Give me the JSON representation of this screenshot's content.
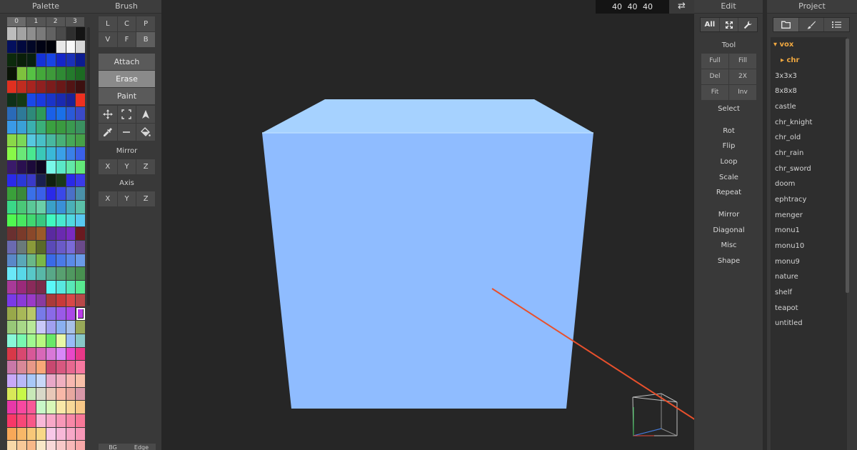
{
  "palette": {
    "title": "Palette",
    "tabs": [
      "0",
      "1",
      "2",
      "3"
    ],
    "active_tab": 0,
    "selected_index": 175,
    "rows": [
      [
        "#bdbdbd",
        "#a3a3a3",
        "#8e8e8e",
        "#7a7a7a",
        "#626262",
        "#4a4a4a",
        "#2e2e2e",
        "#141414"
      ],
      [
        "#04105e",
        "#02093e",
        "#020726",
        "#010314",
        "#01020a",
        "#e8e8e8",
        "#f8f8f8",
        "#d6d6d6"
      ],
      [
        "#0c2a0c",
        "#0a1f0a",
        "#082010",
        "#1432d6",
        "#1844e4",
        "#1426c8",
        "#1a30b8",
        "#0c1c90"
      ],
      [
        "#0a1406",
        "#7ec13e",
        "#56c244",
        "#44a83a",
        "#3e9a3a",
        "#2f8a34",
        "#247a2c",
        "#1c6a22"
      ],
      [
        "#e03020",
        "#c02c20",
        "#a82420",
        "#902020",
        "#7c1c1c",
        "#6a1818",
        "#521414",
        "#3c1010"
      ],
      [
        "#0e3018",
        "#143a14",
        "#1a48e8",
        "#1a3ae0",
        "#1a34c8",
        "#1a2ab0",
        "#1a2298",
        "#ee3020"
      ],
      [
        "#2a6ab8",
        "#2e7a98",
        "#2e8a7a",
        "#2e9a5a",
        "#1a60e8",
        "#1a70e8",
        "#2a5ad8",
        "#3a4ac8"
      ],
      [
        "#3a9ae8",
        "#3aa0d8",
        "#3ab0b0",
        "#3ab07a",
        "#3aa040",
        "#3a9a40",
        "#3a9a50",
        "#3a9060"
      ],
      [
        "#8ad848",
        "#7ad858",
        "#56c8e0",
        "#48c0c8",
        "#48b8a0",
        "#48b078",
        "#46a858",
        "#46a048"
      ],
      [
        "#88f848",
        "#6ae878",
        "#4ae890",
        "#3ac8b8",
        "#3ab8d8",
        "#3aa0e8",
        "#3a80e8",
        "#3a60e8"
      ],
      [
        "#3a1a6a",
        "#2a1050",
        "#1c0a3a",
        "#0e0620",
        "#78f8e8",
        "#5ae8c8",
        "#62e8a8",
        "#62e878"
      ],
      [
        "#2a2ae8",
        "#2a38d8",
        "#3a3ac8",
        "#1a2050",
        "#102010",
        "#1a3a1a",
        "#2a2ae8",
        "#3a3ae8"
      ],
      [
        "#3aa03a",
        "#3a8a3a",
        "#3a70e8",
        "#3a60e8",
        "#2a2ae8",
        "#3a48e8",
        "#4a70c8",
        "#4a90a8"
      ],
      [
        "#3ad888",
        "#4ac878",
        "#5ac898",
        "#6ad0a8",
        "#3aa0c8",
        "#3a90d8",
        "#4ab0b8",
        "#5ac0a8"
      ],
      [
        "#50f850",
        "#48e860",
        "#40d870",
        "#38c880",
        "#40f8c0",
        "#48e8d0",
        "#50d8e0",
        "#58c8f0"
      ],
      [
        "#6a3030",
        "#7a3a2a",
        "#8a482a",
        "#9a5a2a",
        "#5a2aa0",
        "#6a2ab0",
        "#7a2ac0",
        "#6a1a20"
      ],
      [
        "#6a6ab0",
        "#6a7a7a",
        "#8a9a3a",
        "#5a6a2a",
        "#5a4ab8",
        "#6a5ac8",
        "#7a6ad8",
        "#6a4a8a"
      ],
      [
        "#5a88c8",
        "#5aa8b8",
        "#6ab888",
        "#7ab848",
        "#3a6ae8",
        "#4a7ae8",
        "#5a8ae8",
        "#6a9ae8"
      ],
      [
        "#6ae8f8",
        "#58d8e8",
        "#58c8c8",
        "#58b8a8",
        "#58a888",
        "#58a070",
        "#509860",
        "#489050"
      ],
      [
        "#a83a98",
        "#9a2a7a",
        "#8a2a5a",
        "#7a2a4a",
        "#5af8f8",
        "#58e8e0",
        "#58e8b8",
        "#58e890"
      ],
      [
        "#7a3ae8",
        "#8a3ad8",
        "#9a3ac8",
        "#8a3aa0",
        "#aa3a3a",
        "#c83a3a",
        "#d84848",
        "#b84848"
      ],
      [
        "#98a84a",
        "#a8b858",
        "#b8c868",
        "#787ae8",
        "#8a6ae8",
        "#9a5ae8",
        "#aa4ae8",
        "#ba3ae8"
      ],
      [
        "#98c878",
        "#a8d888",
        "#b8e898",
        "#c8c8f8",
        "#a0a0f0",
        "#8ab0f0",
        "#a8c0e8",
        "#98a858"
      ],
      [
        "#88f8d8",
        "#78f8b0",
        "#a0f890",
        "#b8f880",
        "#68e868",
        "#e8f8a8",
        "#98bcf8",
        "#88c8c8"
      ],
      [
        "#d83848",
        "#d84870",
        "#d85898",
        "#d868b8",
        "#d878d8",
        "#d888f8",
        "#e848c8",
        "#e83888"
      ],
      [
        "#c878a8",
        "#d88898",
        "#e89888",
        "#f8a878",
        "#c84870",
        "#d85880",
        "#e86890",
        "#f878a0"
      ],
      [
        "#c8a8f8",
        "#b8b8f8",
        "#a8c8f8",
        "#c8d8f8",
        "#e8a8c8",
        "#f0b0c0",
        "#f8b8b0",
        "#f8c0a8"
      ],
      [
        "#d8e858",
        "#c8f848",
        "#c8e8b8",
        "#d8d8c8",
        "#e8c8b8",
        "#f8b8a8",
        "#e8a8a0",
        "#d898a8"
      ],
      [
        "#e838a8",
        "#f848a0",
        "#f85898",
        "#c8f8c8",
        "#d8f8b8",
        "#f8e8a8",
        "#f8d898",
        "#f8c888"
      ],
      [
        "#f83868",
        "#f84878",
        "#f85888",
        "#f8b8d8",
        "#f8a8c8",
        "#f898b8",
        "#f888a8",
        "#f87898"
      ],
      [
        "#f8a858",
        "#f8b868",
        "#f8c878",
        "#f8d888",
        "#f8c8e8",
        "#f8b8d8",
        "#f8a8c8",
        "#f898b8"
      ],
      [
        "#f8d8a8",
        "#f8c898",
        "#f8b888",
        "#f8e8c8",
        "#f8d8d8",
        "#f8c8c8",
        "#f8b8b8",
        "#f8a8a8"
      ],
      [
        "#f8e8a8",
        "#f8f0b8",
        "#f8f8c8",
        "#f8e8e8",
        "#f8f0f0",
        "#f8f8f8",
        "#f0f0f0",
        "#e8e8e8"
      ]
    ]
  },
  "brush": {
    "title": "Brush",
    "row1": [
      "L",
      "C",
      "P"
    ],
    "row2": [
      "V",
      "F",
      "B"
    ],
    "modes": {
      "attach": "Attach",
      "erase": "Erase",
      "paint": "Paint"
    },
    "active_mode": "erase",
    "mirror_label": "Mirror",
    "mirror": [
      "X",
      "Y",
      "Z"
    ],
    "axis_label": "Axis",
    "axis": [
      "X",
      "Y",
      "Z"
    ],
    "bottom_tabs": [
      "BG",
      "Edge"
    ]
  },
  "viewport": {
    "dimensions": "40 40 40",
    "swap_glyph": "⇄",
    "cube_colors": {
      "top": "#a6d2ff",
      "front": "#8fbcff",
      "side_shadow": "#7fa8e6"
    },
    "ray_color": "#e8502c"
  },
  "edit": {
    "title": "Edit",
    "filter_all": "All",
    "tool_label": "Tool",
    "tool_buttons": [
      "Full",
      "Fill",
      "Del",
      "2X",
      "Fit",
      "Inv"
    ],
    "select_label": "Select",
    "group1": [
      "Rot",
      "Flip",
      "Loop",
      "Scale",
      "Repeat"
    ],
    "group2": [
      "Mirror",
      "Diagonal",
      "Misc",
      "Shape"
    ]
  },
  "project": {
    "title": "Project",
    "folder": "▾ vox",
    "subfolder": "▸ chr",
    "files": [
      "3x3x3",
      "8x8x8",
      "castle",
      "chr_knight",
      "chr_old",
      "chr_rain",
      "chr_sword",
      "doom",
      "ephtracy",
      "menger",
      "monu1",
      "monu10",
      "monu9",
      "nature",
      "shelf",
      "teapot",
      "untitled"
    ]
  }
}
